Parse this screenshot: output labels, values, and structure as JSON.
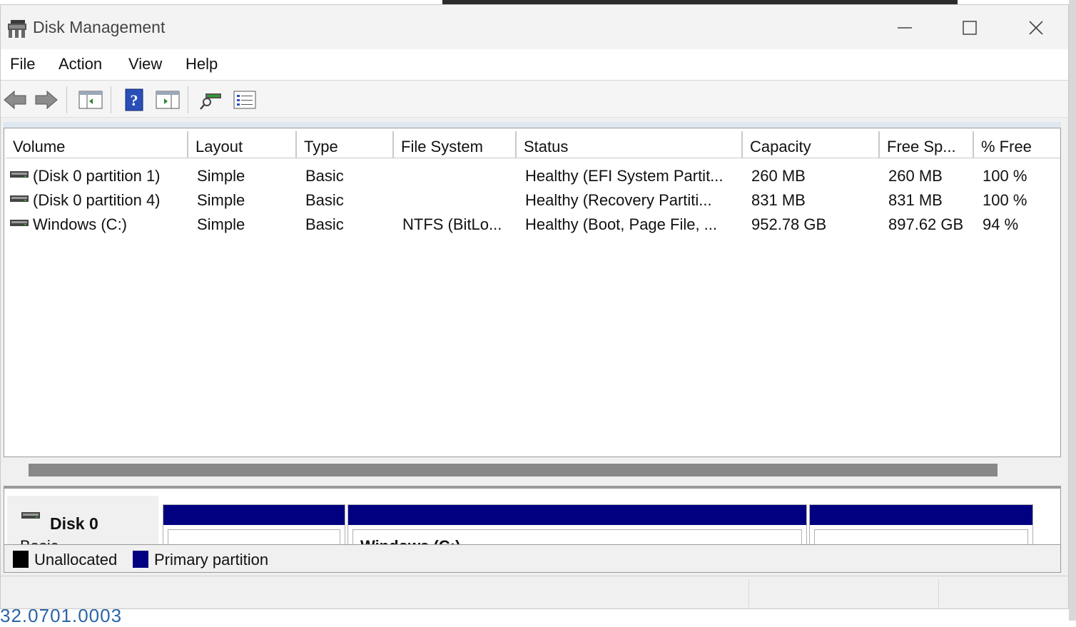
{
  "window": {
    "title": "Disk Management"
  },
  "menu": [
    "File",
    "Action",
    "View",
    "Help"
  ],
  "toolbar": {
    "buttons": [
      "back-arrow-icon",
      "forward-arrow-icon",
      "console-tree-icon",
      "help-icon",
      "action-pane-icon",
      "rescan-disks-icon",
      "properties-icon"
    ]
  },
  "columns": [
    "Volume",
    "Layout",
    "Type",
    "File System",
    "Status",
    "Capacity",
    "Free Sp...",
    "% Free"
  ],
  "volumes": [
    {
      "volume": "(Disk 0 partition 1)",
      "layout": "Simple",
      "type": "Basic",
      "fs": "",
      "status": "Healthy (EFI System Partit...",
      "capacity": "260 MB",
      "free": "260 MB",
      "pct": "100 %"
    },
    {
      "volume": "(Disk 0 partition 4)",
      "layout": "Simple",
      "type": "Basic",
      "fs": "",
      "status": "Healthy (Recovery Partiti...",
      "capacity": "831 MB",
      "free": "831 MB",
      "pct": "100 %"
    },
    {
      "volume": "Windows (C:)",
      "layout": "Simple",
      "type": "Basic",
      "fs": "NTFS (BitLo...",
      "status": "Healthy (Boot, Page File, ...",
      "capacity": "952.78 GB",
      "free": "897.62 GB",
      "pct": "94 %"
    }
  ],
  "disk": {
    "name": "Disk 0",
    "type": "Basic",
    "partitions": [
      {
        "title": ""
      },
      {
        "title": "Windows  (C:)"
      },
      {
        "title": ""
      }
    ]
  },
  "legend": [
    {
      "label": "Unallocated",
      "color": "#000000"
    },
    {
      "label": "Primary partition",
      "color": "#000080"
    }
  ],
  "background": {
    "partial_text": "32.0701.0003"
  }
}
